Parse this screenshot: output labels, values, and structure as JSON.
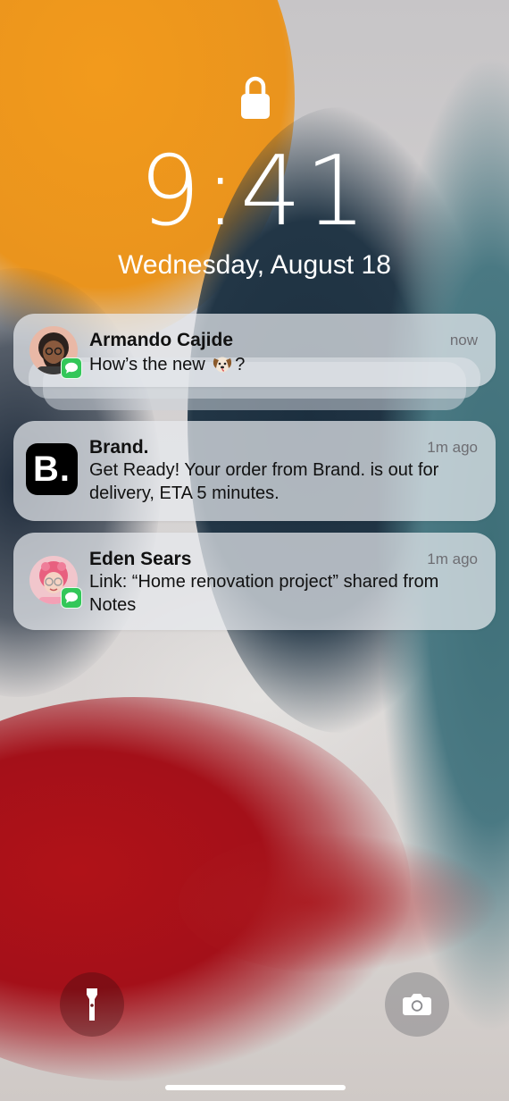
{
  "lock_screen": {
    "lock_icon": "lock-icon",
    "time": "9:41",
    "date": "Wednesday, August 18"
  },
  "notifications": [
    {
      "app": "Messages",
      "icon": "contact-avatar",
      "badge": "messages-icon",
      "sender": "Armando Cajide",
      "timestamp": "now",
      "body_before": "How’s the new ",
      "emoji": "dog-face-emoji",
      "body_after": "?"
    },
    {
      "app": "Brand.",
      "icon": "brand-app-icon",
      "icon_text": "B.",
      "sender": "Brand.",
      "timestamp": "1m ago",
      "body": "Get Ready! Your order from Brand. is out for delivery, ETA 5 minutes."
    },
    {
      "app": "Messages",
      "icon": "contact-avatar",
      "badge": "messages-icon",
      "sender": "Eden Sears",
      "timestamp": "1m ago",
      "body": "Link: “Home renovation project” shared from Notes"
    }
  ],
  "bottom_controls": {
    "left": "flashlight-icon",
    "right": "camera-icon"
  },
  "colors": {
    "messages_green": "#33c759",
    "brand_black": "#000000",
    "text_primary": "#111111",
    "text_secondary": "#6e6e73"
  }
}
